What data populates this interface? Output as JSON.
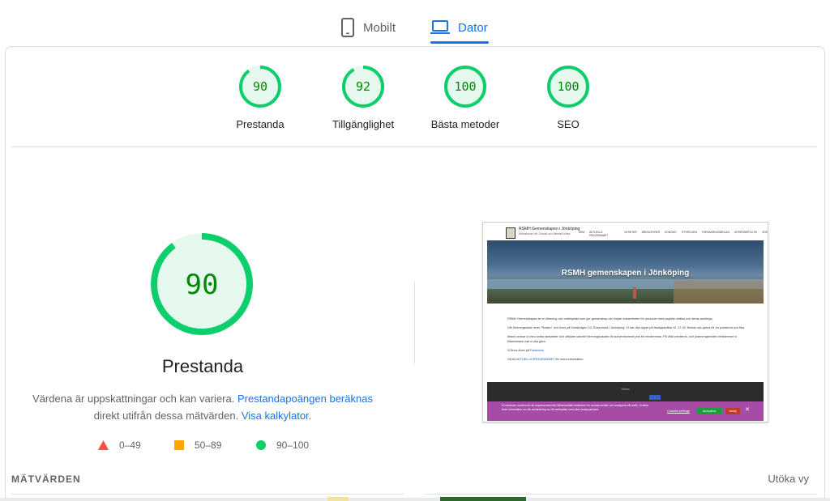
{
  "tabs": {
    "mobile_label": "Mobilt",
    "desktop_label": "Dator",
    "active": "desktop"
  },
  "colors": {
    "pass": "#0cce6b",
    "pass_text": "#008800",
    "pass_bg": "#e6f9ee",
    "average": "#ffa400",
    "fail": "#ff4e42",
    "accent": "#1a73e8"
  },
  "scores": [
    {
      "label": "Prestanda",
      "value": 90
    },
    {
      "label": "Tillgänglighet",
      "value": 92
    },
    {
      "label": "Bästa metoder",
      "value": 100
    },
    {
      "label": "SEO",
      "value": 100
    }
  ],
  "main": {
    "score": 90,
    "title": "Prestanda",
    "desc_prefix": "Värdena är uppskattningar och kan variera.",
    "link_calc": "Prestandapoängen beräknas",
    "desc_middle": "direkt utifrån dessa mätvärden.",
    "link_calculator": "Visa kalkylator",
    "desc_suffix": "."
  },
  "legend": [
    {
      "shape": "triangle",
      "color": "#ff4e42",
      "label": "0–49"
    },
    {
      "shape": "square",
      "color": "#ffa400",
      "label": "50–89"
    },
    {
      "shape": "circle",
      "color": "#0cce6b",
      "label": "90–100"
    }
  ],
  "metrics": {
    "header": "MÄTVÄRDEN",
    "expand_label": "Utöka vy"
  },
  "thumbnail": {
    "site_name": "RSMH Gemenskapen i Jönköping",
    "site_sub": "Mötesforum för Socialt och Mentalt hälsa",
    "nav": [
      "HEM",
      "AKTUELLA PROGRAMMET",
      "NYHETER",
      "BROSCHYRER",
      "KONTAKT",
      "STYRELSEN",
      "FÖRSÄKRINGSBOLAG",
      "INTRESSEPOLITIK",
      "SÖK"
    ],
    "hero_title": "RSMH gemenskapen i Jönköping",
    "paragraphs": [
      "RSMH Gemenskapen är en förening och mötesplats som ger gemenskap och bryter ensamheten för personer med psykisk ohälsa och deras anhöriga.",
      "Vår föreningslokal heter \"Rosten\" och finns på Korallvägen 10, Rosenlund i Jönköping. Vi har ofta öppet på tisdagskvällar Kl. 17-20. Besök oss gärna för en pratstund och fika.",
      "Ibland ordnar vi med andra aktiviteter och utflykter utanför föreningslokalen till subventionerat pris för medlemmar. På våra medlems- och planeringsmöten bestämmer vi tillsammans vad vi ska göra."
    ],
    "facebook_prefix": "Vi finns även på",
    "facebook_link": "Facebook",
    "program_prefix": "Gå till",
    "program_link": "AKTUELLA PROGRAMMET",
    "program_suffix": "för mera information",
    "footer_text": "Hälsa",
    "cookie_text": "Vi använder cookies för att anpassa innehåll, tillhandahålla funktioner för sociala medier och analysera vår trafik. Vi delar även information om din användning av vår webbplats med våra analyspartners.",
    "cookie_settings": "Cookies settings",
    "cookie_accept": "Acceptera",
    "cookie_reject": "Avböj",
    "cookie_close": "✕"
  }
}
